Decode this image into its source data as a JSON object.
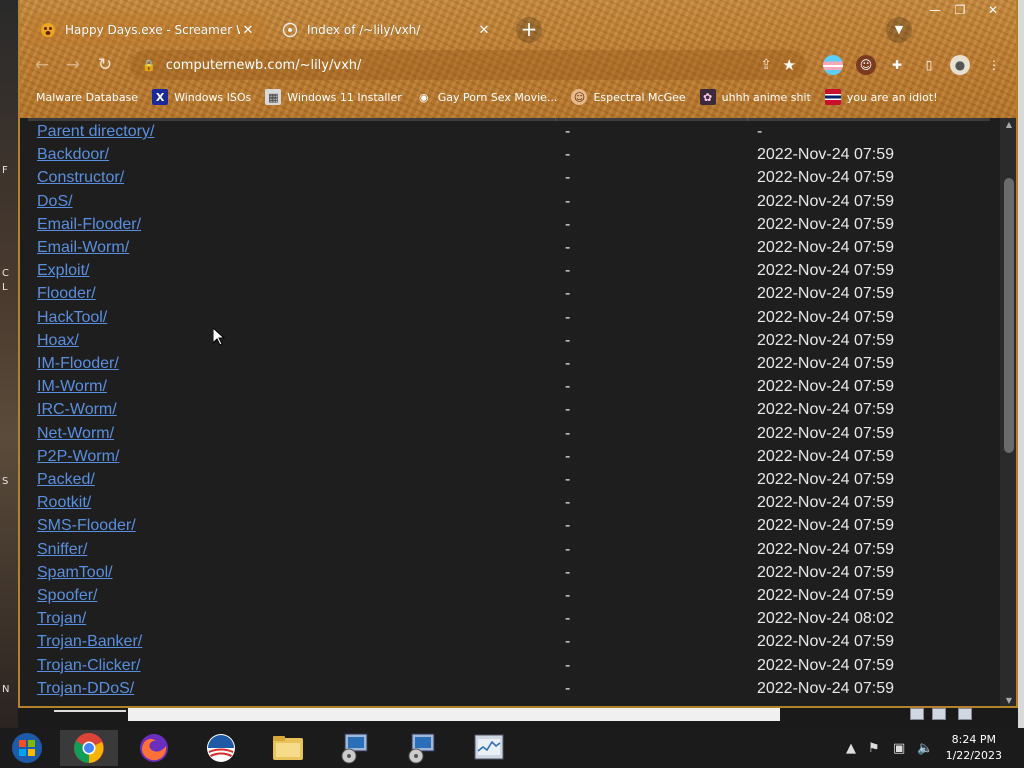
{
  "desktop": {
    "glyphs": [
      "F",
      "C",
      "L",
      "S",
      "N"
    ]
  },
  "window_controls": {
    "minimize": "—",
    "maximize": "❐",
    "close": "✕"
  },
  "tabs": [
    {
      "title": "Happy Days.exe - Screamer Wiki",
      "favicon": "screamer-wiki-icon",
      "active": true
    },
    {
      "title": "Index of /~lily/vxh/",
      "favicon": "directory-icon",
      "active": false
    }
  ],
  "toolbar": {
    "url": "computernewb.com/~lily/vxh/"
  },
  "bookmarks": [
    {
      "label": "Malware Database",
      "icon": "none"
    },
    {
      "label": "Windows ISOs",
      "icon": "x-icon"
    },
    {
      "label": "Windows 11 Installer",
      "icon": "installer-icon"
    },
    {
      "label": "Gay Porn Sex Movie...",
      "icon": "disc-icon"
    },
    {
      "label": "Espectral McGee",
      "icon": "face-icon"
    },
    {
      "label": "uhhh anime shit",
      "icon": "anime-icon"
    },
    {
      "label": "you are an idiot!",
      "icon": "flag-icon"
    }
  ],
  "listing": {
    "rows": [
      {
        "name": "Parent directory/",
        "size": "-",
        "date": "-"
      },
      {
        "name": "Backdoor/",
        "size": "-",
        "date": "2022-Nov-24 07:59"
      },
      {
        "name": "Constructor/",
        "size": "-",
        "date": "2022-Nov-24 07:59"
      },
      {
        "name": "DoS/",
        "size": "-",
        "date": "2022-Nov-24 07:59"
      },
      {
        "name": "Email-Flooder/",
        "size": "-",
        "date": "2022-Nov-24 07:59"
      },
      {
        "name": "Email-Worm/",
        "size": "-",
        "date": "2022-Nov-24 07:59"
      },
      {
        "name": "Exploit/",
        "size": "-",
        "date": "2022-Nov-24 07:59"
      },
      {
        "name": "Flooder/",
        "size": "-",
        "date": "2022-Nov-24 07:59"
      },
      {
        "name": "HackTool/",
        "size": "-",
        "date": "2022-Nov-24 07:59"
      },
      {
        "name": "Hoax/",
        "size": "-",
        "date": "2022-Nov-24 07:59"
      },
      {
        "name": "IM-Flooder/",
        "size": "-",
        "date": "2022-Nov-24 07:59"
      },
      {
        "name": "IM-Worm/",
        "size": "-",
        "date": "2022-Nov-24 07:59"
      },
      {
        "name": "IRC-Worm/",
        "size": "-",
        "date": "2022-Nov-24 07:59"
      },
      {
        "name": "Net-Worm/",
        "size": "-",
        "date": "2022-Nov-24 07:59"
      },
      {
        "name": "P2P-Worm/",
        "size": "-",
        "date": "2022-Nov-24 07:59"
      },
      {
        "name": "Packed/",
        "size": "-",
        "date": "2022-Nov-24 07:59"
      },
      {
        "name": "Rootkit/",
        "size": "-",
        "date": "2022-Nov-24 07:59"
      },
      {
        "name": "SMS-Flooder/",
        "size": "-",
        "date": "2022-Nov-24 07:59"
      },
      {
        "name": "Sniffer/",
        "size": "-",
        "date": "2022-Nov-24 07:59"
      },
      {
        "name": "SpamTool/",
        "size": "-",
        "date": "2022-Nov-24 07:59"
      },
      {
        "name": "Spoofer/",
        "size": "-",
        "date": "2022-Nov-24 07:59"
      },
      {
        "name": "Trojan/",
        "size": "-",
        "date": "2022-Nov-24 08:02"
      },
      {
        "name": "Trojan-Banker/",
        "size": "-",
        "date": "2022-Nov-24 07:59"
      },
      {
        "name": "Trojan-Clicker/",
        "size": "-",
        "date": "2022-Nov-24 07:59"
      },
      {
        "name": "Trojan-DDoS/",
        "size": "-",
        "date": "2022-Nov-24 07:59"
      }
    ]
  },
  "colors": {
    "link": "#5a8fe0",
    "chrome": "#c07d2e",
    "page_bg": "#1e1e1e",
    "window_border": "#b3812c"
  },
  "taskbar": {
    "items": [
      "start-orb-icon",
      "chrome-icon",
      "firefox-icon",
      "obama-logo-icon",
      "file-explorer-icon",
      "setup-icon",
      "setup-icon",
      "task-manager-icon"
    ],
    "clock": {
      "time": "8:24 PM",
      "date": "1/22/2023"
    }
  }
}
